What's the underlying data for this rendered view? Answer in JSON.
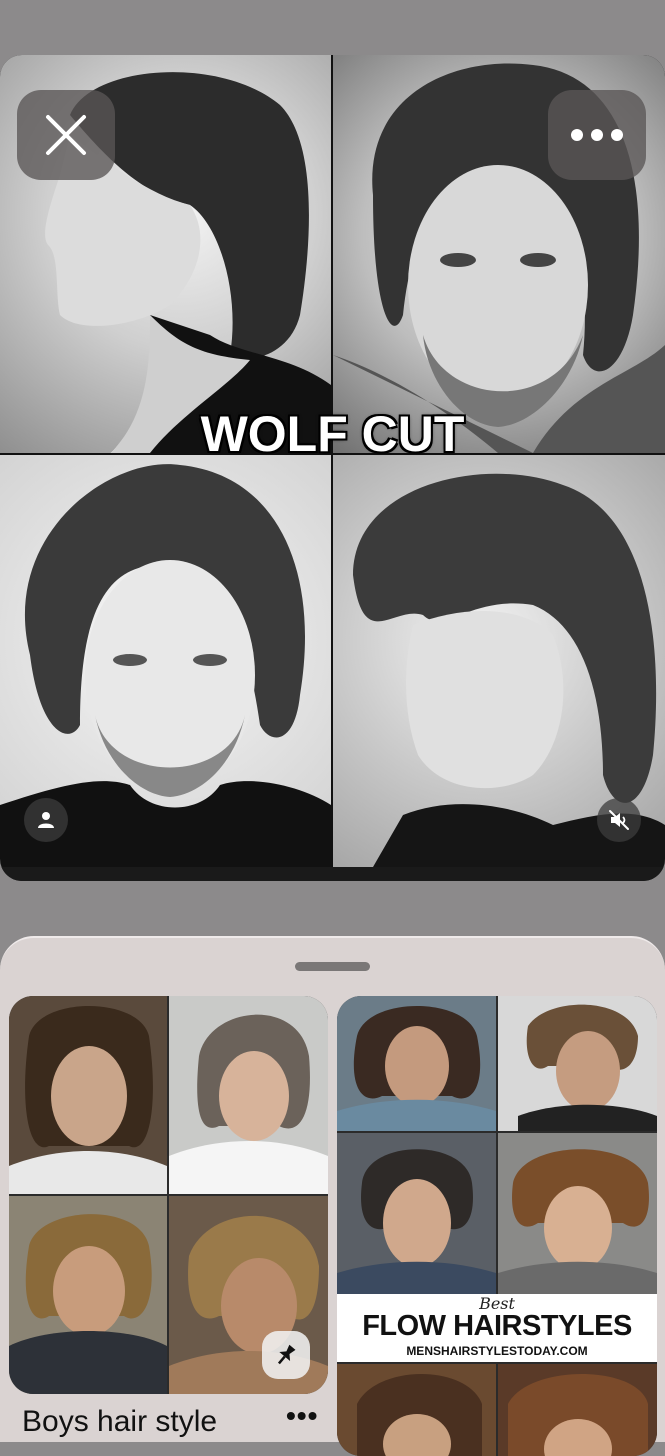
{
  "pin": {
    "overlay_title": "WOLF CUT",
    "close_icon": "close-icon",
    "more_icon": "more-horizontal-icon",
    "profile_icon": "user-icon",
    "mute_icon": "volume-mute-icon"
  },
  "sheet": {
    "board_title": "Boys hair style",
    "board_more": "•••",
    "pin_icon": "pushpin-icon",
    "flow_banner": {
      "best": "Best",
      "title": "FLOW HAIRSTYLES",
      "url": "MENSHAIRSTYLESTODAY.COM"
    }
  },
  "colors": {
    "background": "#8c8a8b",
    "sheet": "#dad3d2",
    "button_overlay": "#5a5656"
  }
}
